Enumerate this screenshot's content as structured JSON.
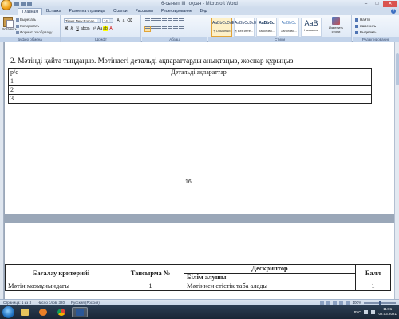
{
  "window": {
    "title": "6-сынып III тоқсан - Microsoft Word"
  },
  "ribbon": {
    "tabs": [
      "Главная",
      "Вставка",
      "Разметка страницы",
      "Ссылки",
      "Рассылки",
      "Рецензирование",
      "Вид"
    ],
    "active_tab": "Главная",
    "clipboard": {
      "paste_label": "Вставить",
      "cut_label": "Вырезать",
      "copy_label": "Копировать",
      "format_painter_label": "Формат по образцу",
      "group_label": "Буфер обмена"
    },
    "font": {
      "font_name": "Times New Roman",
      "font_size": "14",
      "group_label": "Шрифт"
    },
    "paragraph": {
      "group_label": "Абзац"
    },
    "styles": {
      "items": [
        {
          "sample": "AaBbCcDdE",
          "name": "¶ Обычный"
        },
        {
          "sample": "AaBbCcDdE",
          "name": "¶ Без инте..."
        },
        {
          "sample": "AaBbCc",
          "name": "Заголово..."
        },
        {
          "sample": "AaBbCc",
          "name": "Заголово..."
        },
        {
          "sample": "AaB",
          "name": "Название"
        }
      ],
      "change_styles_label": "Изменить стили",
      "group_label": "Стили"
    },
    "editing": {
      "find_label": "Найти",
      "replace_label": "Заменить",
      "select_label": "Выделить",
      "group_label": "Редактирование"
    }
  },
  "document": {
    "page1": {
      "task_heading": "2. Мәтінді қайта тыңдаңыз. Мәтіндегі детальді ақпараттарды анықтаңыз, жоспар құрыңыз",
      "table": {
        "headers": [
          "р/с",
          "Детальді  ақпараттар"
        ],
        "rows": [
          [
            "1",
            ""
          ],
          [
            "2",
            ""
          ],
          [
            "3",
            ""
          ]
        ]
      },
      "page_number": "16"
    },
    "page2": {
      "table": {
        "headers": [
          "Бағалау критерийі",
          "Тапсырма №",
          "Дескриптор",
          "Балл"
        ],
        "subheader": "Білім алушы",
        "rows": [
          [
            "Мәтін мазмұнындағы",
            "1",
            "Мәтіннен етістік таба алады",
            "1"
          ]
        ]
      }
    }
  },
  "statusbar": {
    "page": "Страница: 1 из 3",
    "words": "Число слов: 320",
    "language": "Русский (Россия)",
    "zoom": "100%"
  },
  "taskbar": {
    "lang": "РУС",
    "time": "11:01",
    "date": "02.03.2021"
  }
}
